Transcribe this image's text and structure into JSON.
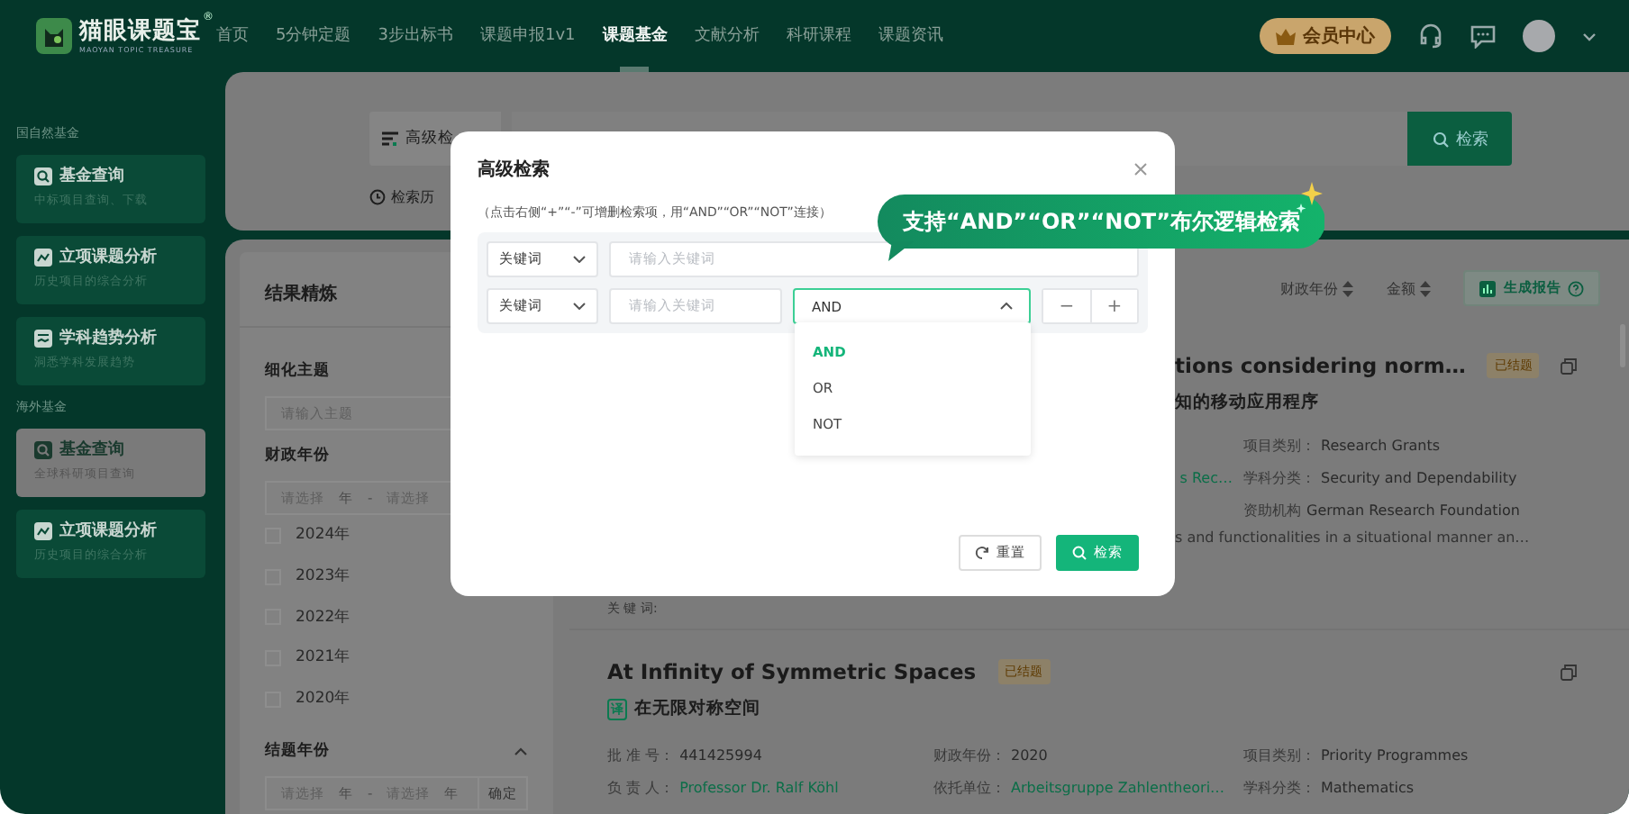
{
  "nav": {
    "logo": {
      "name": "猫眼课题宝",
      "registered": "®",
      "tagline": "MAOYAN TOPIC TREASURE"
    },
    "items": [
      {
        "label": "首页",
        "selected": false
      },
      {
        "label": "5分钟定题",
        "selected": false
      },
      {
        "label": "3步出标书",
        "selected": false
      },
      {
        "label": "课题申报1v1",
        "selected": false
      },
      {
        "label": "课题基金",
        "selected": true
      },
      {
        "label": "文献分析",
        "selected": false
      },
      {
        "label": "科研课程",
        "selected": false
      },
      {
        "label": "课题资讯",
        "selected": false
      }
    ],
    "member_button": "会员中心"
  },
  "sidebar": {
    "sections": [
      {
        "title": "国自然基金",
        "items": [
          {
            "title": "基金查询",
            "subtitle": "中标项目查询、下载",
            "kind": "search",
            "selected": false
          },
          {
            "title": "立项课题分析",
            "subtitle": "历史项目的综合分析",
            "kind": "analysis",
            "selected": false
          },
          {
            "title": "学科趋势分析",
            "subtitle": "洞悉学科发展趋势",
            "kind": "trend",
            "selected": false
          }
        ]
      },
      {
        "title": "海外基金",
        "items": [
          {
            "title": "基金查询",
            "subtitle": "全球科研项目查询",
            "kind": "search",
            "selected": true
          },
          {
            "title": "立项课题分析",
            "subtitle": "历史项目的综合分析",
            "kind": "analysis",
            "selected": false
          }
        ]
      }
    ]
  },
  "search_panel": {
    "advanced_button": "高级检",
    "history": "检索历",
    "search_button": "检索"
  },
  "filters": {
    "title": "结果精炼",
    "topic": {
      "label": "细化主题",
      "placeholder": "请输入主题"
    },
    "fiscal_year": {
      "label": "财政年份",
      "from_placeholder": "请选择",
      "from_unit": "年",
      "separator": "-",
      "to_placeholder": "请选择"
    },
    "years": [
      {
        "label": "2024年",
        "checked": false
      },
      {
        "label": "2023年",
        "checked": false
      },
      {
        "label": "2022年",
        "checked": false
      },
      {
        "label": "2021年",
        "checked": false
      },
      {
        "label": "2020年",
        "checked": false
      }
    ],
    "end_year": {
      "label": "结题年份",
      "expanded": true,
      "from_placeholder": "请选择",
      "from_unit": "年",
      "separator": "-",
      "to_placeholder": "请选择",
      "to_unit": "年",
      "confirm": "确定"
    }
  },
  "results": {
    "sort": [
      {
        "label": "财政年份"
      },
      {
        "label": "金额"
      }
    ],
    "report_button": "生成报告",
    "cards": [
      {
        "title": "tions considering norm…",
        "status": "已结题",
        "translation": "知的移动应用程序",
        "rows": [
          [
            null,
            null,
            {
              "label": "项目类别：",
              "value": "Research Grants",
              "link": false
            }
          ],
          [
            null,
            {
              "value": "s Rec…",
              "link": true
            },
            {
              "label": "学科分类：",
              "value": "Security and Dependability",
              "link": false
            }
          ],
          [
            null,
            null,
            {
              "label": "资助机构",
              "value": "German Research Foundation",
              "link": false
            }
          ]
        ],
        "abstract": "s and functionalities in a situational manner an…",
        "keywords_label": "关 键 词:"
      },
      {
        "title": "At Infinity of Symmetric Spaces",
        "status": "已结题",
        "translate_mark": "译",
        "translation": "在无限对称空间",
        "rows": [
          [
            {
              "label": "批 准 号：",
              "value": "441425994",
              "link": false
            },
            {
              "label": "财政年份：",
              "value": "2020",
              "link": false
            },
            {
              "label": "项目类别：",
              "value": "Priority Programmes",
              "link": false
            }
          ],
          [
            {
              "label": "负 责 人：",
              "value": "Professor Dr. Ralf Köhl",
              "link": true
            },
            {
              "label": "依托单位：",
              "value": "Arbeitsgruppe Zahlentheori…",
              "link": true
            },
            {
              "label": "学科分类：",
              "value": "Mathematics",
              "link": false
            }
          ]
        ]
      }
    ]
  },
  "modal": {
    "title": "高级检索",
    "hint": "（点击右侧“+”“-”可增删检索项，用“AND”“OR”“NOT”连接）",
    "rows": [
      {
        "field": "关键词",
        "placeholder": "请输入关键词"
      },
      {
        "field": "关键词",
        "placeholder": "请输入关键词",
        "operator": {
          "value": "AND",
          "expanded": true
        },
        "remove": "−",
        "add": "+"
      }
    ],
    "operator_options": [
      {
        "label": "AND",
        "selected": true
      },
      {
        "label": "OR",
        "selected": false
      },
      {
        "label": "NOT",
        "selected": false
      }
    ],
    "buttons": [
      {
        "label": "重置",
        "kind": "reset"
      },
      {
        "label": "检索",
        "kind": "search"
      }
    ]
  },
  "tooltip": {
    "text": "支持“AND”“OR”“NOT”布尔逻辑检索"
  }
}
